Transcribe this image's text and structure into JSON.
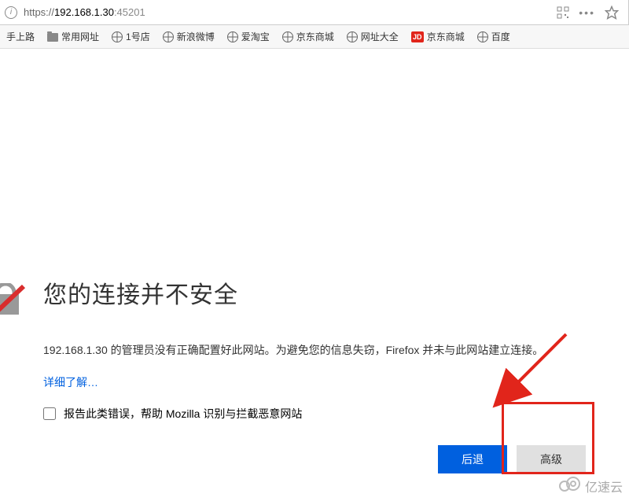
{
  "address": {
    "prefix": "https://",
    "ip": "192.168.1.30",
    "port": ":45201"
  },
  "bookmarks": {
    "b0": "手上路",
    "b1": "常用网址",
    "b2": "1号店",
    "b3": "新浪微博",
    "b4": "爱淘宝",
    "b5": "京东商城",
    "b6": "网址大全",
    "b7_badge": "JD",
    "b7": "京东商城",
    "b8": "百度"
  },
  "error": {
    "title": "您的连接并不安全",
    "desc": "192.168.1.30 的管理员没有正确配置好此网站。为避免您的信息失窃，Firefox 并未与此网站建立连接。",
    "learn_more": "详细了解…",
    "report_label": "报告此类错误，帮助 Mozilla 识别与拦截恶意网站",
    "back_button": "后退",
    "advanced_button": "高级"
  },
  "watermark": {
    "text": "亿速云"
  }
}
